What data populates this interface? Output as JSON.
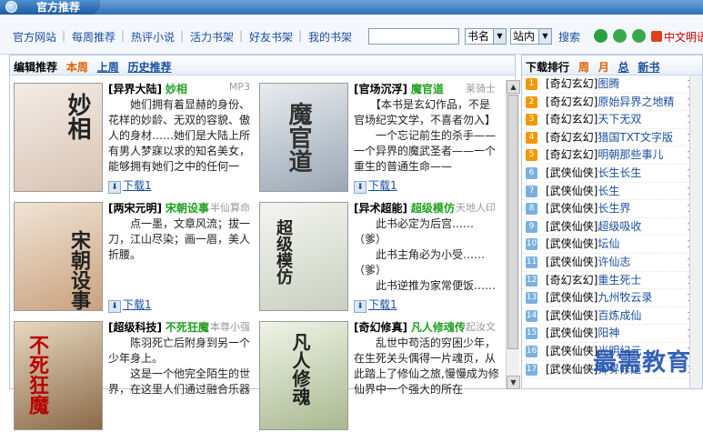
{
  "window": {
    "title": "官方推荐"
  },
  "nav": {
    "links": [
      "官方网站",
      "每周推荐",
      "热评小说",
      "活力书架",
      "好友书架",
      "我的书架"
    ],
    "search_type": "书名",
    "search_scope": "站内",
    "search_button": "搜索",
    "lang_link": "中文明语"
  },
  "left": {
    "heading": "编辑推荐",
    "tabs": [
      "本周",
      "上周",
      "历史推荐"
    ],
    "download_label": "下载1",
    "cards": [
      {
        "category": "[异界大陆]",
        "name": "妙相",
        "author": "MP3",
        "desc": "　　她们拥有着显赫的身份、花样的妙龄、无双的容貌、傲人的身材……她们是大陆上所有男人梦寐以求的知名美女，能够拥有她们之中的任何一",
        "cover_text": "妙相",
        "cover_color": "#e9ddd3"
      },
      {
        "category": "[官场沉浮]",
        "name": "魔官道",
        "author": "莱骑士",
        "desc": "　　【本书是玄幻作品，不是官场纪实文学，不喜者勿入】\n　　一个忘记前生的杀手——一个异界的魔武圣者——一个重生的普通生命——",
        "cover_text": "魔官道",
        "cover_color": "#cdd4dc"
      },
      {
        "category": "[两宋元明]",
        "name": "宋朝设事",
        "author": "半仙算命",
        "desc": "　　点一墨，文章风流；拔一刀，江山尽染；画一眉，美人折腰。",
        "cover_text": "宋朝设事",
        "cover_color": "#ead9c6"
      },
      {
        "category": "[异术超能]",
        "name": "超级模仿",
        "author": "天地人印",
        "desc": "　　此书必定为后宫……（爹）\n　　此书主角必为小受……（爹）\n　　此书逆推为家常便饭……",
        "cover_text": "超级模仿",
        "cover_color": "#e6e6e0"
      },
      {
        "category": "[超级科技]",
        "name": "不死狂魔",
        "author": "本尊小强",
        "desc": "　　陈羽死亡后附身到另一个少年身上。\n　　这是一个他完全陌生的世界，在这里人们通过融合乐器",
        "cover_text": "不死狂魔",
        "cover_color": "#d9c9b0"
      },
      {
        "category": "[奇幻修真]",
        "name": "凡人修魂传",
        "author": "起汝文",
        "desc": "　　乱世中苟活的穷困少年，在生死关头偶得一片魂页，从此踏上了修仙之旅,慢慢成为修仙界中一个强大的所在",
        "cover_text": "凡人修魂",
        "cover_color": "#e4ecd6"
      }
    ]
  },
  "right": {
    "heading": "下载排行",
    "tabs": [
      "周",
      "月",
      "总",
      "新书"
    ],
    "items": [
      {
        "rank": "1",
        "category": "[奇幻玄幻]",
        "name": "图腾",
        "count": "1"
      },
      {
        "rank": "2",
        "category": "[奇幻玄幻]",
        "name": "原始异界之地精",
        "count": "1"
      },
      {
        "rank": "3",
        "category": "[奇幻玄幻]",
        "name": "天下无双",
        "count": "1"
      },
      {
        "rank": "4",
        "category": "[奇幻玄幻]",
        "name": "猎国TXT文字版",
        "count": "1"
      },
      {
        "rank": "5",
        "category": "[奇幻玄幻]",
        "name": "明朝那些事儿",
        "count": "1"
      },
      {
        "rank": "6",
        "category": "[武侠仙侠]",
        "name": "长生长生",
        "count": "1"
      },
      {
        "rank": "7",
        "category": "[武侠仙侠]",
        "name": "长生",
        "count": "1"
      },
      {
        "rank": "8",
        "category": "[武侠仙侠]",
        "name": "长生界",
        "count": "1"
      },
      {
        "rank": "9",
        "category": "[武侠仙侠]",
        "name": "超级吸收",
        "count": "1"
      },
      {
        "rank": "10",
        "category": "[武侠仙侠]",
        "name": "坛仙",
        "count": "1"
      },
      {
        "rank": "11",
        "category": "[武侠仙侠]",
        "name": "许仙志",
        "count": "1"
      },
      {
        "rank": "12",
        "category": "[奇幻玄幻]",
        "name": "重生死士",
        "count": "1"
      },
      {
        "rank": "13",
        "category": "[武侠仙侠]",
        "name": "九州牧云录",
        "count": "1"
      },
      {
        "rank": "14",
        "category": "[武侠仙侠]",
        "name": "百炼成仙",
        "count": "1"
      },
      {
        "rank": "15",
        "category": "[武侠仙侠]",
        "name": "阳神",
        "count": "1"
      },
      {
        "rank": "16",
        "category": "[武侠仙侠]",
        "name": "光明纪元",
        "count": "1"
      },
      {
        "rank": "17",
        "category": "[武侠仙侠]",
        "name": "异界修道",
        "count": "1"
      }
    ]
  },
  "watermark": "最需教育"
}
